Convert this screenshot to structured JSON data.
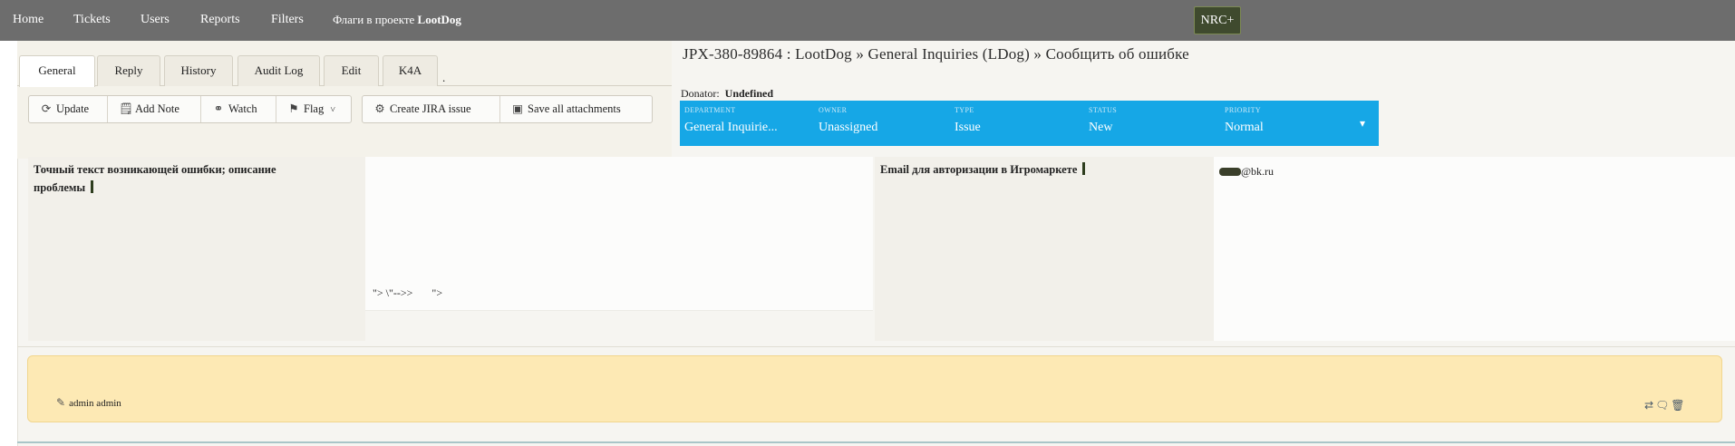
{
  "nav": {
    "items": [
      "Home",
      "Tickets",
      "Users",
      "Reports",
      "Filters"
    ],
    "project_prefix": "Флаги в проекте",
    "project_name": "LootDog",
    "nrc_label": "NRC+"
  },
  "tabs": [
    "General",
    "Reply",
    "History",
    "Audit Log",
    "Edit",
    "K4A"
  ],
  "tabs_trailing": ".",
  "toolbar": {
    "update": "Update",
    "add_note": "Add Note",
    "watch": "Watch",
    "flag": "Flag",
    "flag_caret": "˅",
    "create_jira": "Create  JIRA issue",
    "save_attachments": "Save  all attachments"
  },
  "ticket": {
    "title": "JPX-380-89864 : LootDog » General Inquiries (LDog) » Сообщить об ошибке",
    "donator_label": "Donator:",
    "donator_value": "Undefined"
  },
  "status_bar": {
    "department_label": "DEPARTMENT",
    "department_value": "General   Inquirie...",
    "owner_label": "OWNER",
    "owner_value": "Unassigned",
    "type_label": "TYPE",
    "type_value": "Issue",
    "status_label": "STATUS",
    "status_value": "New",
    "priority_label": "PRIORITY",
    "priority_value": "Normal",
    "bg_color": "#16a7e6"
  },
  "fields": {
    "error_label_line1": "Точный текст возникающей ошибки; описание",
    "error_label_line2": "проблемы",
    "error_value": "\"> \\\"-->>       \">",
    "email_label": "Email для авторизации в Игромаркете",
    "email_suffix": "@bk.ru"
  },
  "note": {
    "author": "admin admin",
    "bg_color": "#fde9b4"
  },
  "icons": {
    "update": "refresh-circle-icon",
    "add_note": "note-icon",
    "watch": "binoculars-icon",
    "flag": "flag-icon",
    "jira": "jira-icon",
    "save": "save-icon",
    "filter": "filter-icon",
    "author": "pencil-icon",
    "shuffle": "shuffle-icon",
    "comment": "comment-icon",
    "trash": "trash-icon"
  }
}
